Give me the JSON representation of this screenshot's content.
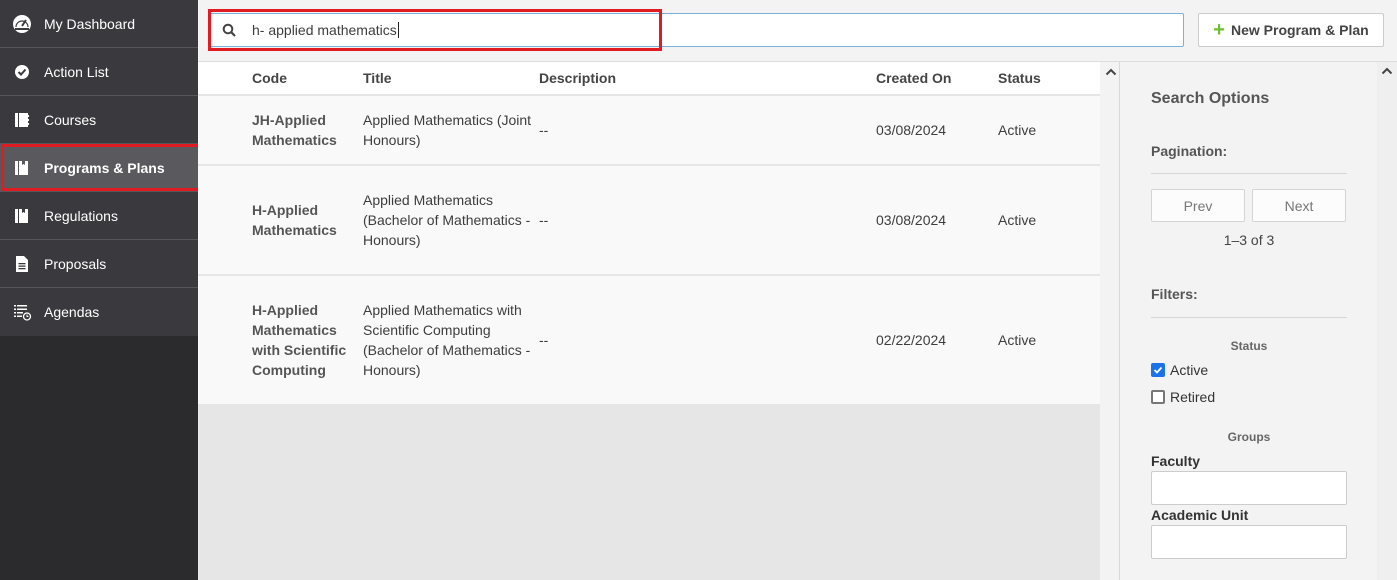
{
  "sidebar": {
    "items": [
      {
        "label": "My Dashboard",
        "icon": "dashboard-gauge-icon",
        "active": false
      },
      {
        "label": "Action List",
        "icon": "check-circle-icon",
        "active": false
      },
      {
        "label": "Courses",
        "icon": "book-icon",
        "active": false
      },
      {
        "label": "Programs & Plans",
        "icon": "bookmark-book-icon",
        "active": true
      },
      {
        "label": "Regulations",
        "icon": "bookmark-book-icon",
        "active": false
      },
      {
        "label": "Proposals",
        "icon": "document-icon",
        "active": false
      },
      {
        "label": "Agendas",
        "icon": "list-clock-icon",
        "active": false
      }
    ]
  },
  "search": {
    "value": "h- applied mathematics",
    "icon": "search-icon"
  },
  "toolbar": {
    "new_label": "New Program & Plan",
    "new_icon": "plus-icon"
  },
  "table": {
    "headers": {
      "code": "Code",
      "title": "Title",
      "description": "Description",
      "created_on": "Created On",
      "status": "Status"
    },
    "rows": [
      {
        "code": "JH-Applied Mathematics",
        "title": "Applied Mathematics (Joint Honours)",
        "description": "--",
        "created_on": "03/08/2024",
        "status": "Active"
      },
      {
        "code": "H-Applied Mathematics",
        "title": "Applied Mathematics (Bachelor of Mathematics - Honours)",
        "description": "--",
        "created_on": "03/08/2024",
        "status": "Active"
      },
      {
        "code": "H-Applied Mathematics with Scientific Computing",
        "title": "Applied Mathematics with Scientific Computing (Bachelor of Mathematics - Honours)",
        "description": "--",
        "created_on": "02/22/2024",
        "status": "Active"
      }
    ]
  },
  "search_options": {
    "title": "Search Options",
    "pagination_label": "Pagination:",
    "prev_label": "Prev",
    "next_label": "Next",
    "count_text": "1–3 of 3",
    "filters_label": "Filters:",
    "status_heading": "Status",
    "status_options": [
      {
        "label": "Active",
        "checked": true
      },
      {
        "label": "Retired",
        "checked": false
      }
    ],
    "groups_heading": "Groups",
    "faculty_label": "Faculty",
    "faculty_value": "",
    "academic_unit_label": "Academic Unit",
    "academic_unit_value": ""
  },
  "colors": {
    "highlight": "#e11b22",
    "sidebar_bg": "#3a3a3e",
    "sidebar_active_bg": "#5a5a5e",
    "plus_green": "#6cbf2e",
    "checkbox_blue": "#1a73e8"
  }
}
